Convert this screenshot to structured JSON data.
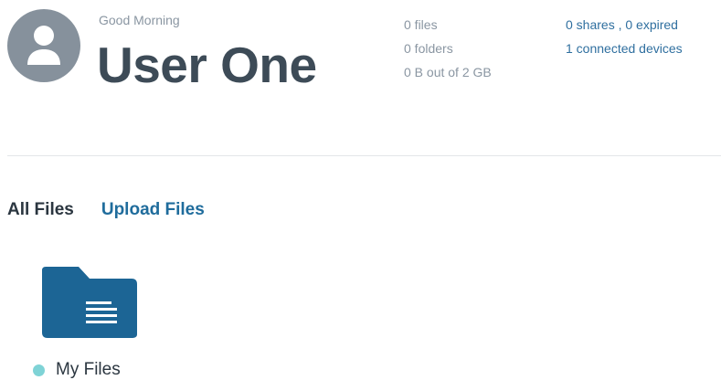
{
  "header": {
    "greeting": "Good Morning",
    "user_name": "User One",
    "avatar_icon": "user-icon"
  },
  "stats": {
    "files": "0 files",
    "folders": "0 folders",
    "storage": "0 B out of 2 GB"
  },
  "shares": {
    "shares_expired": "0 shares , 0 expired",
    "devices": "1 connected devices"
  },
  "tabs": [
    {
      "label": "All Files"
    },
    {
      "label": "Upload Files"
    }
  ],
  "folders": [
    {
      "name": "My Files",
      "icon": "folder-icon",
      "status_color": "#7fd3d6"
    }
  ],
  "colors": {
    "accent": "#1f6c9c",
    "folder": "#1c6595",
    "avatar_bg": "#86919c"
  }
}
